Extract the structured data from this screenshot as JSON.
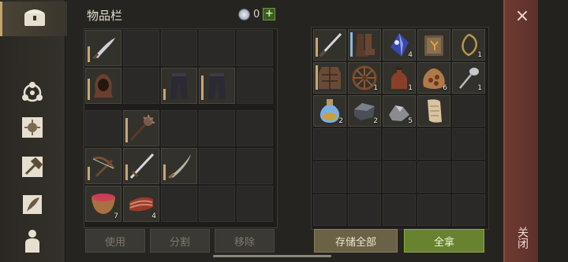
{
  "header": {
    "title": "物品栏",
    "currency_count": "0"
  },
  "actions": {
    "use": "使用",
    "split": "分割",
    "remove": "移除",
    "store_all": "存储全部",
    "take_all": "全拿"
  },
  "close": {
    "label": "关闭",
    "x": "×"
  },
  "sidebar": [
    "chest-icon",
    "molecule-icon",
    "sun-card-icon",
    "hammer-map-icon",
    "feather-scroll-icon",
    "character-icon"
  ],
  "inventory_top": [
    {
      "icon": "sword",
      "dur": 0.6
    },
    {},
    {},
    {},
    {},
    {
      "icon": "hood",
      "dur": 0.8
    },
    {},
    {
      "icon": "pants",
      "dur": 0.4
    },
    {
      "icon": "pants",
      "dur": 0.9
    },
    {}
  ],
  "inventory_bottom": [
    {},
    {
      "icon": "mace",
      "dur": 0.9
    },
    {},
    {},
    {},
    {
      "icon": "crossbow",
      "dur": 0.5
    },
    {
      "icon": "longsword",
      "dur": 0.6
    },
    {
      "icon": "saber",
      "dur": 0.6
    },
    {},
    {},
    {
      "icon": "bowl",
      "qty": "7"
    },
    {
      "icon": "meat",
      "qty": "4"
    },
    {},
    {},
    {}
  ],
  "storage": [
    {
      "icon": "blade",
      "dur": 0.7
    },
    {
      "icon": "boots",
      "dur": 0.9,
      "blue": true
    },
    {
      "icon": "crystal",
      "qty": "4"
    },
    {
      "icon": "book"
    },
    {
      "icon": "rope",
      "qty": "1"
    },
    {
      "icon": "armor",
      "dur": 0.9
    },
    {
      "icon": "wheel",
      "qty": "1"
    },
    {
      "icon": "bottle",
      "qty": "1"
    },
    {
      "icon": "sack",
      "qty": "6"
    },
    {
      "icon": "spoon",
      "qty": "1"
    },
    {
      "icon": "potion",
      "qty": "2"
    },
    {
      "icon": "ingot",
      "qty": "2"
    },
    {
      "icon": "ore",
      "qty": "5"
    },
    {
      "icon": "paper"
    },
    {},
    {},
    {},
    {},
    {},
    {},
    {},
    {},
    {},
    {},
    {},
    {},
    {},
    {},
    {},
    {}
  ]
}
